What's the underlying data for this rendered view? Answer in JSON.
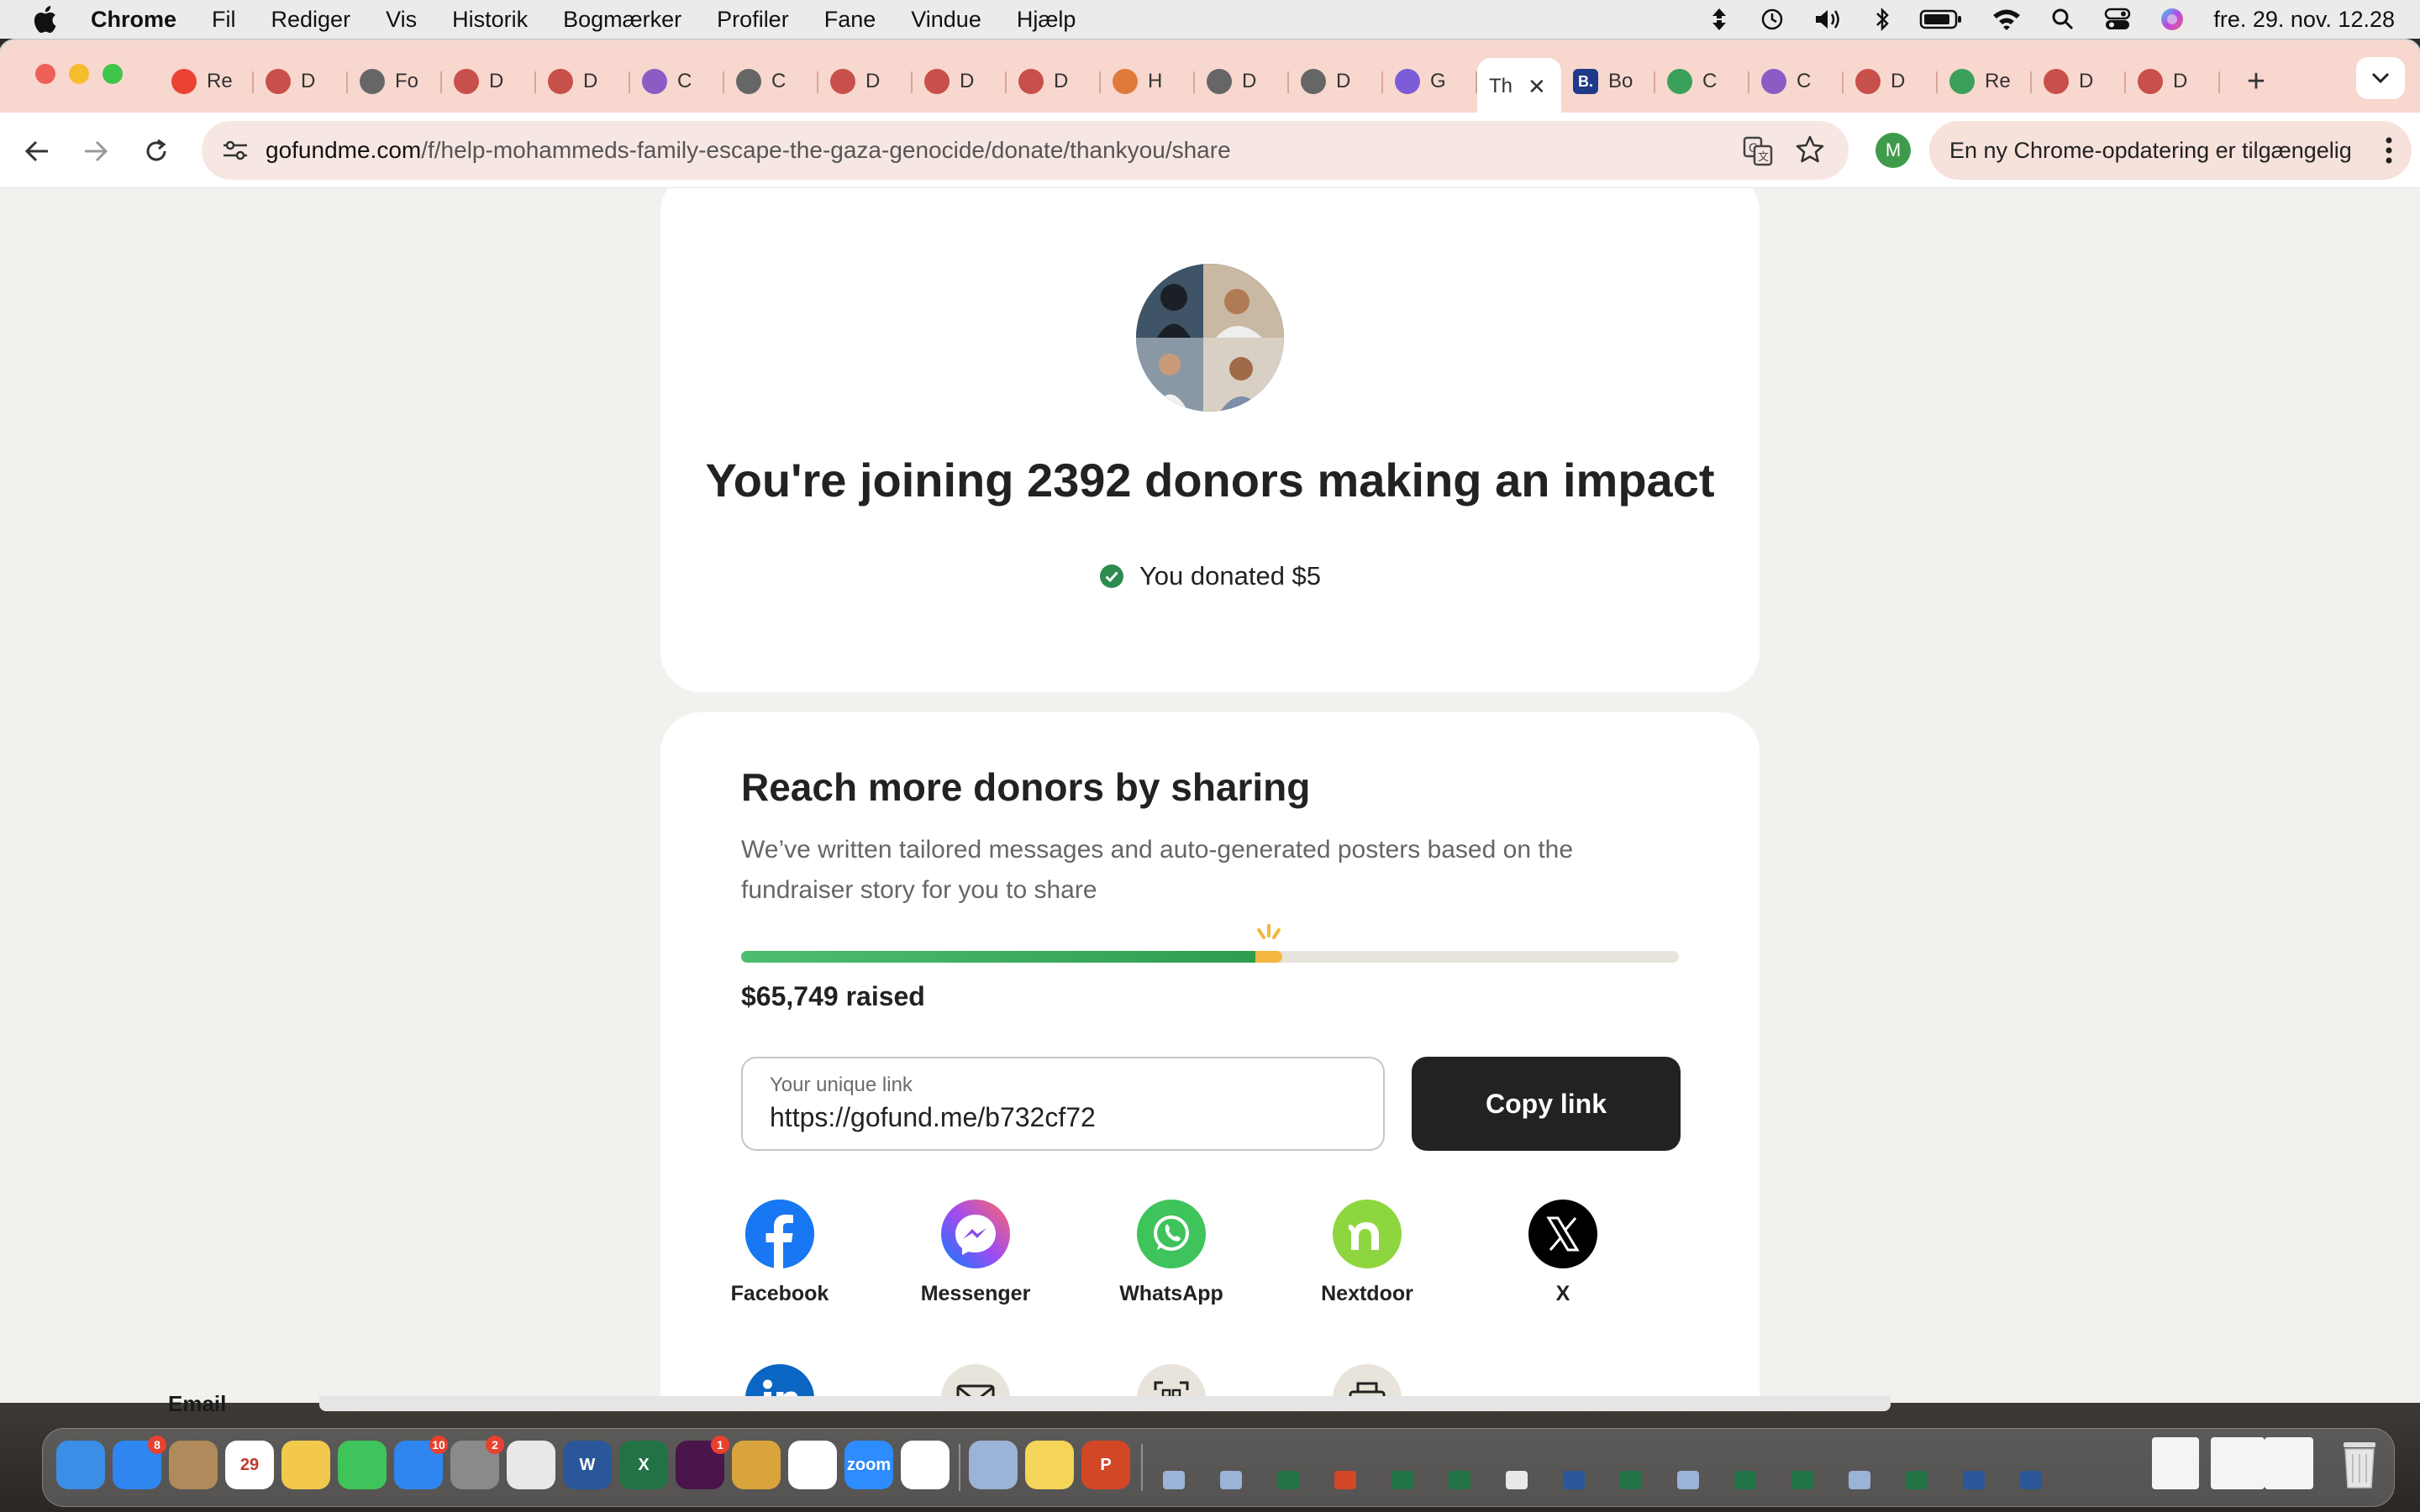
{
  "menubar": {
    "app": "Chrome",
    "items": [
      "Fil",
      "Rediger",
      "Vis",
      "Historik",
      "Bogmærker",
      "Profiler",
      "Fane",
      "Vindue",
      "Hjælp"
    ],
    "clock": "fre. 29. nov.  12.28"
  },
  "tabs": [
    {
      "icon": "gmail-icon",
      "label": "Re",
      "color": "#ea4335"
    },
    {
      "icon": "tab-favicon-icon",
      "label": "D",
      "color": "#c8504a"
    },
    {
      "icon": "globe-icon",
      "label": "Fo",
      "color": "#666666"
    },
    {
      "icon": "tab-favicon-icon",
      "label": "D",
      "color": "#c8504a"
    },
    {
      "icon": "tab-favicon-icon",
      "label": "D",
      "color": "#c8504a"
    },
    {
      "icon": "tab-favicon-icon",
      "label": "C",
      "color": "#8a5cc4"
    },
    {
      "icon": "globe-icon",
      "label": "C",
      "color": "#666666"
    },
    {
      "icon": "tab-favicon-icon",
      "label": "D",
      "color": "#c8504a"
    },
    {
      "icon": "tab-favicon-icon",
      "label": "D",
      "color": "#c8504a"
    },
    {
      "icon": "tab-favicon-icon",
      "label": "D",
      "color": "#c8504a"
    },
    {
      "icon": "tab-favicon-icon",
      "label": "H",
      "color": "#e07a3a"
    },
    {
      "icon": "globe-icon",
      "label": "D",
      "color": "#666666"
    },
    {
      "icon": "globe-icon",
      "label": "D",
      "color": "#666666"
    },
    {
      "icon": "tab-favicon-icon",
      "label": "G",
      "color": "#7c5cd6"
    }
  ],
  "active_tab": {
    "label": "Th"
  },
  "tabs_after": [
    {
      "icon": "booking-icon",
      "label": "Bo",
      "color": "#1f3a8a",
      "letter": "B."
    },
    {
      "icon": "crown-icon",
      "label": "C",
      "color": "#3aa05a"
    },
    {
      "icon": "tab-favicon-icon",
      "label": "C",
      "color": "#8a5cc4"
    },
    {
      "icon": "tab-favicon-icon",
      "label": "D",
      "color": "#c8504a"
    },
    {
      "icon": "crown-icon",
      "label": "Re",
      "color": "#3aa05a"
    },
    {
      "icon": "tab-favicon-icon",
      "label": "D",
      "color": "#c8504a"
    },
    {
      "icon": "tab-favicon-icon",
      "label": "D",
      "color": "#c8504a"
    }
  ],
  "toolbar": {
    "url_host": "gofundme.com",
    "url_path": "/f/help-mohammeds-family-escape-the-gaza-genocide/donate/thankyou/share",
    "profile_letter": "M",
    "update_text": "En ny Chrome-opdatering er tilgængelig"
  },
  "page": {
    "headline": "You're joining 2392 donors making an impact",
    "donated": "You donated $5",
    "share_title": "Reach more donors by sharing",
    "share_desc": "We’ve written tailored messages and auto-generated posters based on the fundraiser story for you to share",
    "progress_fraction": 0.548,
    "raised": "$65,749 raised",
    "link_label": "Your unique link",
    "link_value": "https://gofund.me/b732cf72",
    "copy_label": "Copy link",
    "share_options": [
      {
        "label": "Facebook",
        "icon": "facebook-icon",
        "color": "#1877f2"
      },
      {
        "label": "Messenger",
        "icon": "messenger-icon",
        "color": "#a24bf0"
      },
      {
        "label": "WhatsApp",
        "icon": "whatsapp-icon",
        "color": "#3fc35b"
      },
      {
        "label": "Nextdoor",
        "icon": "nextdoor-icon",
        "color": "#8ed63f"
      },
      {
        "label": "X",
        "icon": "x-icon",
        "color": "#000000"
      }
    ],
    "share_options_row2": [
      {
        "icon": "linkedin-icon",
        "color": "#0a66c2"
      },
      {
        "icon": "email-icon",
        "color": "#e8e4dc"
      },
      {
        "icon": "qr-code-icon",
        "color": "#e8e4dc"
      },
      {
        "icon": "printer-icon",
        "color": "#e8e4dc"
      }
    ]
  },
  "dock": {
    "peek_label": "Email",
    "apps": [
      {
        "icon": "finder-icon",
        "color": "#3a8ee6"
      },
      {
        "icon": "mail-icon",
        "color": "#2f86f0",
        "badge": "8"
      },
      {
        "icon": "contacts-icon",
        "color": "#b08a5a"
      },
      {
        "icon": "calendar-icon",
        "color": "#ffffff",
        "text": "29"
      },
      {
        "icon": "photos-icon",
        "color": "#f2c94c"
      },
      {
        "icon": "messages-icon",
        "color": "#3fc35b"
      },
      {
        "icon": "app-store-icon",
        "color": "#2f86f0",
        "badge": "10"
      },
      {
        "icon": "system-settings-icon",
        "color": "#8a8a8a",
        "badge": "2"
      },
      {
        "icon": "chrome-icon",
        "color": "#e8e8e8"
      },
      {
        "icon": "word-icon",
        "color": "#2b579a",
        "text": "W"
      },
      {
        "icon": "excel-icon",
        "color": "#217346",
        "text": "X"
      },
      {
        "icon": "slack-icon",
        "color": "#4a154b",
        "badge": "1"
      },
      {
        "icon": "database-icon",
        "color": "#d9a43c"
      },
      {
        "icon": "clickup-icon",
        "color": "#ffffff"
      },
      {
        "icon": "zoom-icon",
        "color": "#2d8cff",
        "text": "zoom"
      },
      {
        "icon": "freeform-icon",
        "color": "#ffffff"
      },
      {
        "icon": "preview-icon",
        "color": "#9bb3d6"
      },
      {
        "icon": "notes-icon",
        "color": "#f5d45a"
      },
      {
        "icon": "powerpoint-icon",
        "color": "#d24726",
        "text": "P"
      }
    ]
  },
  "colors": {
    "tabstrip": "#f8d7cf",
    "progress_green": "#2e9e4e",
    "progress_yellow": "#f3b63f",
    "button_dark": "#222222"
  }
}
